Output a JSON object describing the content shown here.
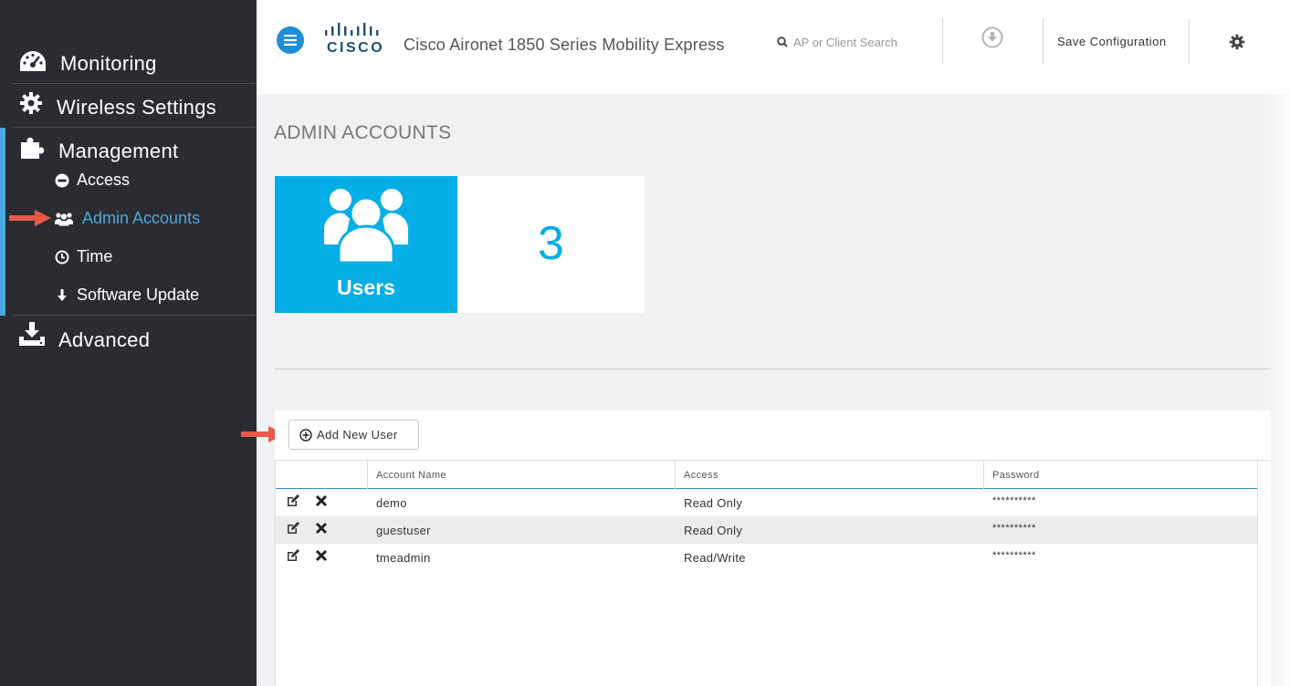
{
  "header": {
    "brand": "CISCO",
    "title": "Cisco Aironet 1850 Series Mobility Express",
    "search_placeholder": "AP or Client Search",
    "save_label": "Save Configuration"
  },
  "sidebar": {
    "items": [
      {
        "label": "Monitoring",
        "icon": "dashboard-icon"
      },
      {
        "label": "Wireless Settings",
        "icon": "gear-icon"
      },
      {
        "label": "Management",
        "icon": "puzzle-icon"
      },
      {
        "label": "Advanced",
        "icon": "download-tray-icon"
      }
    ],
    "management_sub": [
      {
        "label": "Access",
        "icon": "minus-circle-icon"
      },
      {
        "label": "Admin Accounts",
        "icon": "users-icon",
        "active": true
      },
      {
        "label": "Time",
        "icon": "clock-icon"
      },
      {
        "label": "Software Update",
        "icon": "arrow-down-icon"
      }
    ]
  },
  "main": {
    "page_title": "ADMIN ACCOUNTS",
    "tile": {
      "label": "Users",
      "count": "3"
    },
    "add_button": "Add New User",
    "table": {
      "columns": [
        "Account Name",
        "Access",
        "Password"
      ],
      "rows": [
        {
          "name": "demo",
          "access": "Read Only",
          "password": "**********"
        },
        {
          "name": "guestuser",
          "access": "Read Only",
          "password": "**********"
        },
        {
          "name": "tmeadmin",
          "access": "Read/Write",
          "password": "**********"
        }
      ]
    }
  },
  "colors": {
    "sidebar_bg": "#2b2c31",
    "accent": "#4aa8df",
    "tile_blue": "#05aee6",
    "menu_button": "#1c8fd6",
    "annotation_arrow": "#e8594a"
  }
}
